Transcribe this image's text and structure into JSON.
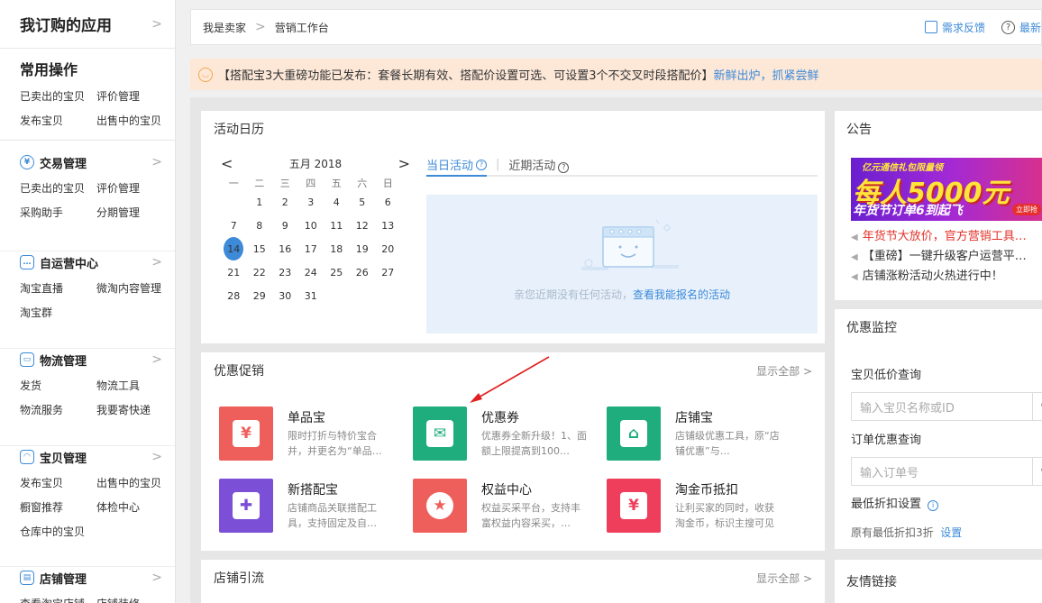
{
  "sidebar": {
    "header": "我订购的应用",
    "common": {
      "title": "常用操作",
      "links": [
        "已卖出的宝贝",
        "评价管理",
        "发布宝贝",
        "出售中的宝贝"
      ]
    },
    "sections": [
      {
        "title": "交易管理",
        "icon": "yuan-icon",
        "links": [
          "已卖出的宝贝",
          "评价管理",
          "采购助手",
          "分期管理"
        ]
      },
      {
        "title": "自运营中心",
        "icon": "chat-icon",
        "links": [
          "淘宝直播",
          "微淘内容管理",
          "淘宝群"
        ]
      },
      {
        "title": "物流管理",
        "icon": "truck-icon",
        "links": [
          "发货",
          "物流工具",
          "物流服务",
          "我要寄快递"
        ]
      },
      {
        "title": "宝贝管理",
        "icon": "bag-icon",
        "links": [
          "发布宝贝",
          "出售中的宝贝",
          "橱窗推荐",
          "体检中心",
          "仓库中的宝贝"
        ]
      },
      {
        "title": "店铺管理",
        "icon": "store-icon",
        "links": [
          "查看淘宝店铺",
          "店铺装修"
        ]
      }
    ]
  },
  "topbar": {
    "crumbs": [
      "我是卖家",
      "营销工作台"
    ],
    "feedback": "需求反馈",
    "latest": "最新"
  },
  "notice": {
    "text": "【搭配宝3大重磅功能已发布：套餐长期有效、搭配价设置可选、可设置3个不交叉时段搭配价】",
    "link": "新鲜出炉，抓紧尝鲜"
  },
  "calendar": {
    "title": "活动日历",
    "month": "五月 2018",
    "weekdays": [
      "一",
      "二",
      "三",
      "四",
      "五",
      "六",
      "日"
    ],
    "leading_blanks": 1,
    "days": 31,
    "today": 14,
    "tab_today": "当日活动",
    "tab_recent": "近期活动",
    "empty_text": "亲您近期没有任何活动，",
    "empty_link": "查看我能报名的活动"
  },
  "promo": {
    "title": "优惠促销",
    "more": "显示全部",
    "items": [
      {
        "name": "单品宝",
        "desc": "限时打折与特价宝合并，并更名为“单品…",
        "color": "#ee5f5b",
        "icon": "shield-yuan-icon"
      },
      {
        "name": "优惠券",
        "desc": "优惠券全新升级！1、面额上限提高到100…",
        "color": "#1fad7e",
        "icon": "envelope-yuan-icon"
      },
      {
        "name": "店铺宝",
        "desc": "店铺级优惠工具，原“店铺优惠”与…",
        "color": "#1fad7e",
        "icon": "shop-gear-icon"
      },
      {
        "name": "新搭配宝",
        "desc": "店铺商品关联搭配工具，支持固定及自…",
        "color": "#7b4fd6",
        "icon": "puzzle-icon"
      },
      {
        "name": "权益中心",
        "desc": "权益买采平台，支持丰富权益内容采买，…",
        "color": "#ee5f5b",
        "icon": "star-badge-icon"
      },
      {
        "name": "淘金币抵扣",
        "desc": "让利买家的同时，收获淘金币，标识主搜可见",
        "color": "#ee3e5c",
        "icon": "coins-icon"
      }
    ]
  },
  "traffic": {
    "title": "店铺引流",
    "more": "显示全部"
  },
  "announce": {
    "title": "公告",
    "banner": {
      "line1": "亿元通信礼包限量领",
      "line2": "每人5000元",
      "line3": "年货节订单6到起飞",
      "button": "立即抢"
    },
    "items": [
      {
        "text": "年货节大放价，官方营销工具…",
        "highlight": true
      },
      {
        "text": "【重磅】一键升级客户运营平…",
        "highlight": false
      },
      {
        "text": "店铺涨粉活动火热进行中！",
        "highlight": false
      }
    ]
  },
  "monitor": {
    "title": "优惠监控",
    "q1_label": "宝贝低价查询",
    "q1_placeholder": "输入宝贝名称或ID",
    "q2_label": "订单优惠查询",
    "q2_placeholder": "输入订单号",
    "min_label": "最低折扣设置",
    "min_text": "原有最低折扣3折",
    "min_link": "设置"
  },
  "friend": {
    "title": "友情链接"
  }
}
